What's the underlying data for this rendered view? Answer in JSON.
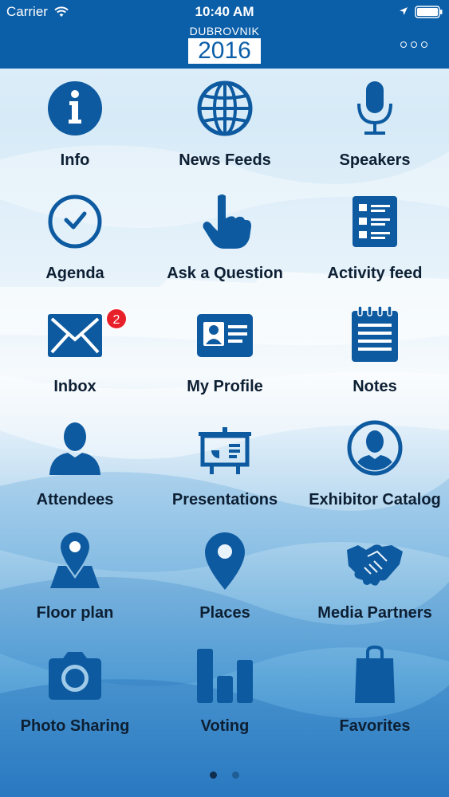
{
  "status_bar": {
    "carrier": "Carrier",
    "time": "10:40 AM",
    "icons": [
      "wifi-icon",
      "location-arrow-icon",
      "battery-icon"
    ]
  },
  "header": {
    "logo_city": "DUBROVNIK",
    "logo_year": "2016",
    "more_icon": "ellipsis-icon"
  },
  "menu": [
    {
      "label": "Info",
      "icon": "info-icon"
    },
    {
      "label": "News Feeds",
      "icon": "globe-icon"
    },
    {
      "label": "Speakers",
      "icon": "microphone-icon"
    },
    {
      "label": "Agenda",
      "icon": "clock-icon"
    },
    {
      "label": "Ask a Question",
      "icon": "pointing-hand-icon"
    },
    {
      "label": "Activity feed",
      "icon": "list-icon"
    },
    {
      "label": "Inbox",
      "icon": "envelope-icon",
      "badge": "2"
    },
    {
      "label": "My Profile",
      "icon": "id-card-icon"
    },
    {
      "label": "Notes",
      "icon": "notepad-icon"
    },
    {
      "label": "Attendees",
      "icon": "person-icon"
    },
    {
      "label": "Presentations",
      "icon": "presentation-board-icon"
    },
    {
      "label": "Exhibitor Catalog",
      "icon": "person-circle-icon"
    },
    {
      "label": "Floor plan",
      "icon": "map-pin-icon"
    },
    {
      "label": "Places",
      "icon": "location-pin-icon"
    },
    {
      "label": "Media Partners",
      "icon": "handshake-icon"
    },
    {
      "label": "Photo Sharing",
      "icon": "camera-icon"
    },
    {
      "label": "Voting",
      "icon": "bar-chart-icon"
    },
    {
      "label": "Favorites",
      "icon": "shopping-bag-icon"
    }
  ],
  "pagination": {
    "pages": 2,
    "current": 1
  },
  "colors": {
    "brand": "#0b5ea8",
    "icon": "#0d5aa0",
    "label": "#0d1f33",
    "badge": "#e8202a"
  }
}
